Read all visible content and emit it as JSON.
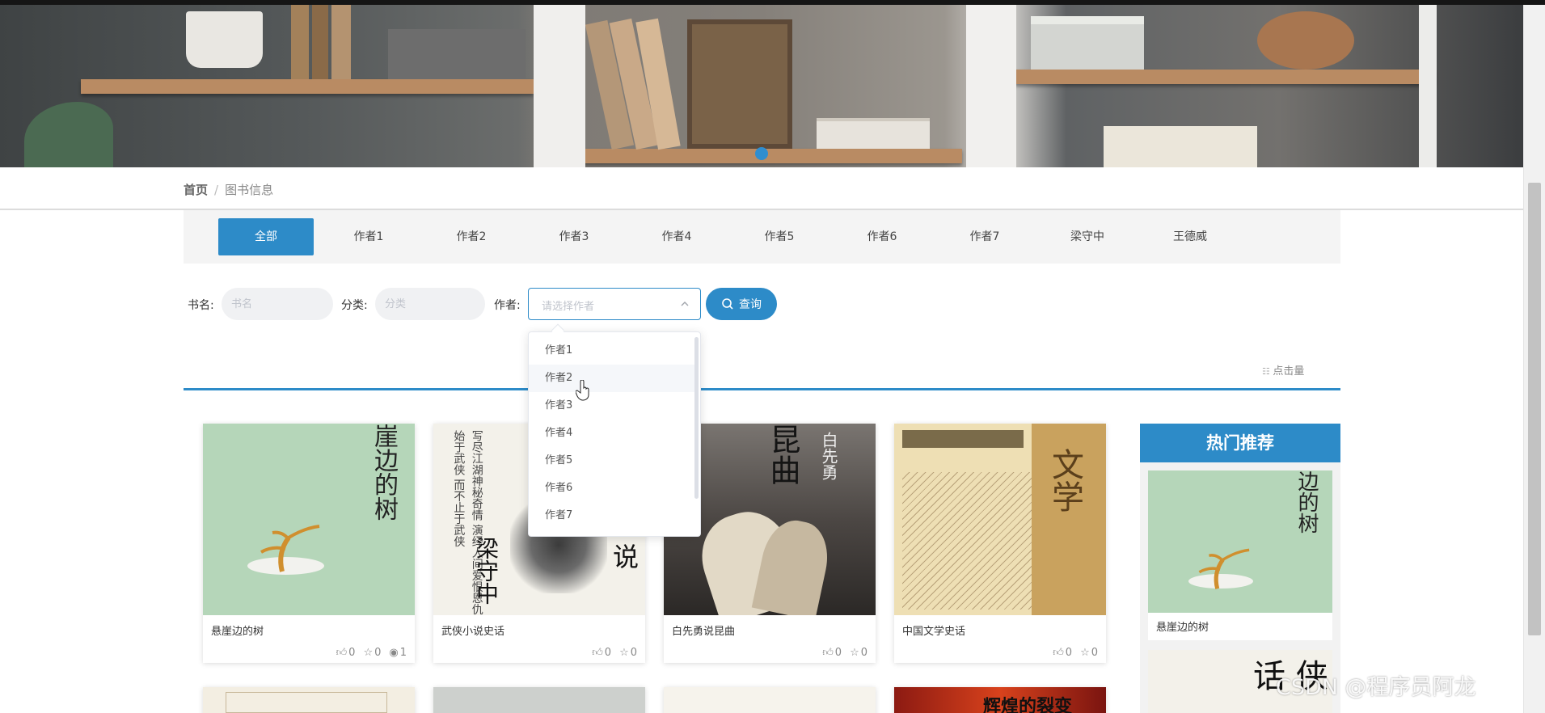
{
  "breadcrumb": {
    "home": "首页",
    "separator": "/",
    "current": "图书信息"
  },
  "author_tabs": [
    "全部",
    "作者1",
    "作者2",
    "作者3",
    "作者4",
    "作者5",
    "作者6",
    "作者7",
    "梁守中",
    "王德威"
  ],
  "active_tab": "全部",
  "search": {
    "title_label": "书名:",
    "title_placeholder": "书名",
    "category_label": "分类:",
    "category_placeholder": "分类",
    "author_label": "作者:",
    "author_placeholder": "请选择作者",
    "query_button": "查询"
  },
  "sort_label": "点击量",
  "author_dropdown": {
    "open": true,
    "items": [
      "作者1",
      "作者2",
      "作者3",
      "作者4",
      "作者5",
      "作者6",
      "作者7"
    ],
    "hovered": "作者2"
  },
  "books": [
    {
      "title": "悬崖边的树",
      "likes": "0",
      "favorites": "0",
      "views": "1"
    },
    {
      "title": "武侠小说史话",
      "likes": "0",
      "favorites": "0"
    },
    {
      "title": "白先勇说昆曲",
      "likes": "0",
      "favorites": "0"
    },
    {
      "title": "中国文学史话",
      "likes": "0",
      "favorites": "0"
    }
  ],
  "hot": {
    "header": "热门推荐",
    "items": [
      {
        "title": "悬崖边的树"
      }
    ]
  },
  "watermark": "CSDN @程序员阿龙",
  "colors": {
    "accent": "#2d8bc8",
    "tab_bar_bg": "#f4f4f4",
    "hot_panel_bg": "#f2f2f2"
  }
}
